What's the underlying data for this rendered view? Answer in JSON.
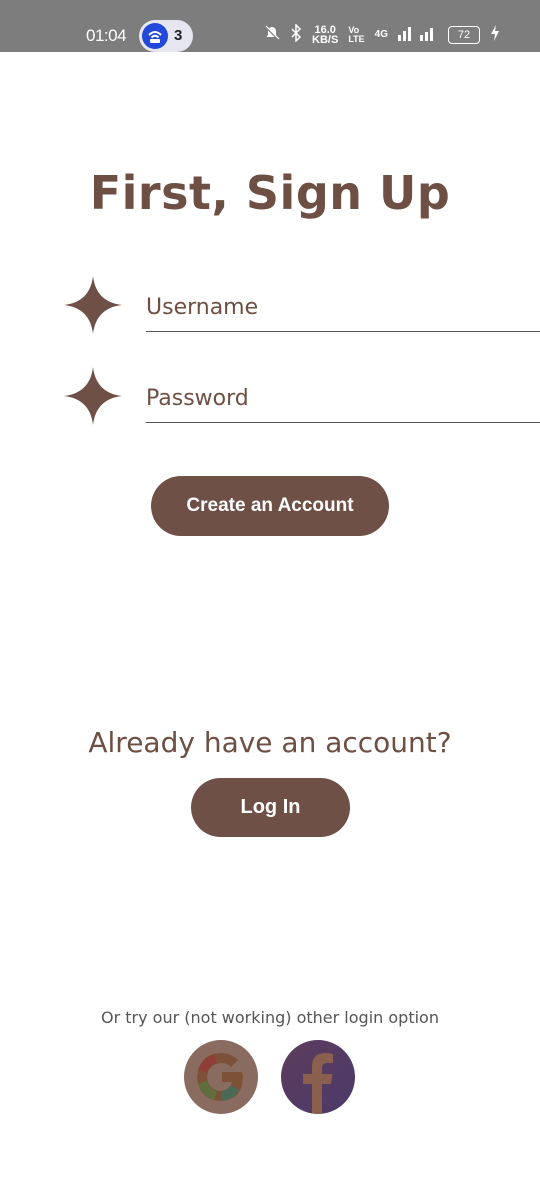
{
  "status_bar": {
    "time": "01:04",
    "notification_count": "3",
    "net_speed_top": "16.0",
    "net_speed_bottom": "KB/S",
    "network": "4G",
    "battery": "72"
  },
  "signup": {
    "title": "First, Sign Up",
    "username_placeholder": "Username",
    "password_placeholder": "Password",
    "create_button": "Create an Account"
  },
  "login": {
    "prompt": "Already have an account?",
    "button": "Log In"
  },
  "alternatives": {
    "text": "Or try our (not working) other login option"
  },
  "colors": {
    "accent": "#6e5046",
    "text": "#6e4f43"
  }
}
